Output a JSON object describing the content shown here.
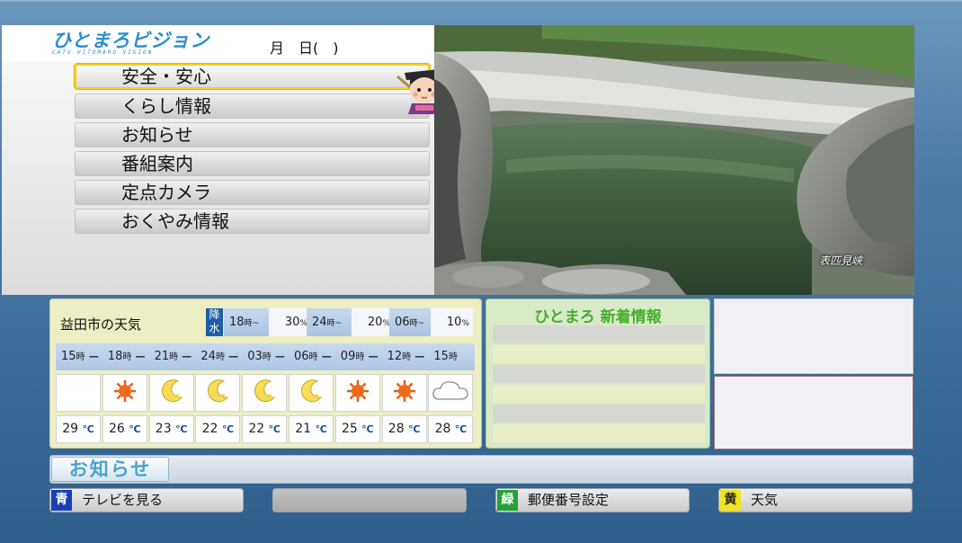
{
  "header": {
    "logo_text": "ひとまろビジョン",
    "logo_subtext": "CATV HITOMARO VISION",
    "date_text": "月　日(　)"
  },
  "menu": {
    "items": [
      {
        "label": "安全・安心",
        "selected": true
      },
      {
        "label": "くらし情報",
        "selected": false
      },
      {
        "label": "お知らせ",
        "selected": false
      },
      {
        "label": "番組案内",
        "selected": false
      },
      {
        "label": "定点カメラ",
        "selected": false
      },
      {
        "label": "おくやみ情報",
        "selected": false
      }
    ]
  },
  "photo": {
    "caption": "表匹見峡"
  },
  "weather": {
    "title": "益田市の天気",
    "precip_label": "降水",
    "precip": [
      {
        "time": "18",
        "unit": "時~",
        "pct": "30",
        "pct_unit": "%"
      },
      {
        "time": "24",
        "unit": "時~",
        "pct": "20",
        "pct_unit": "%"
      },
      {
        "time": "06",
        "unit": "時~",
        "pct": "10",
        "pct_unit": "%"
      }
    ],
    "hours": [
      "15",
      "18",
      "21",
      "24",
      "03",
      "06",
      "09",
      "12",
      "15"
    ],
    "hour_unit": "時",
    "icons": [
      "blank",
      "sun-icon",
      "moon-icon",
      "moon-icon",
      "moon-icon",
      "moon-icon",
      "sun-icon",
      "sun-icon",
      "cloud-icon"
    ],
    "temps": [
      "29",
      "26",
      "23",
      "22",
      "22",
      "21",
      "25",
      "28",
      "28"
    ],
    "temp_unit": "℃"
  },
  "news": {
    "title": "ひとまろ 新着情報"
  },
  "notice": {
    "label": "お知らせ"
  },
  "footer": {
    "buttons": [
      {
        "key": "青",
        "label": "テレビを見る",
        "key_color": "#1740b8"
      },
      {
        "key": "",
        "label": "",
        "key_color": ""
      },
      {
        "key": "緑",
        "label": "郵便番号設定",
        "key_color": "#27a03a"
      },
      {
        "key": "黄",
        "label": "天気",
        "key_color": "#f2e21a"
      }
    ]
  },
  "colors": {
    "logo": "#2b8fd0",
    "news_title": "#48ad2f",
    "selected_border": "#f3cf1d",
    "precip_badge": "#1d5fa6"
  }
}
